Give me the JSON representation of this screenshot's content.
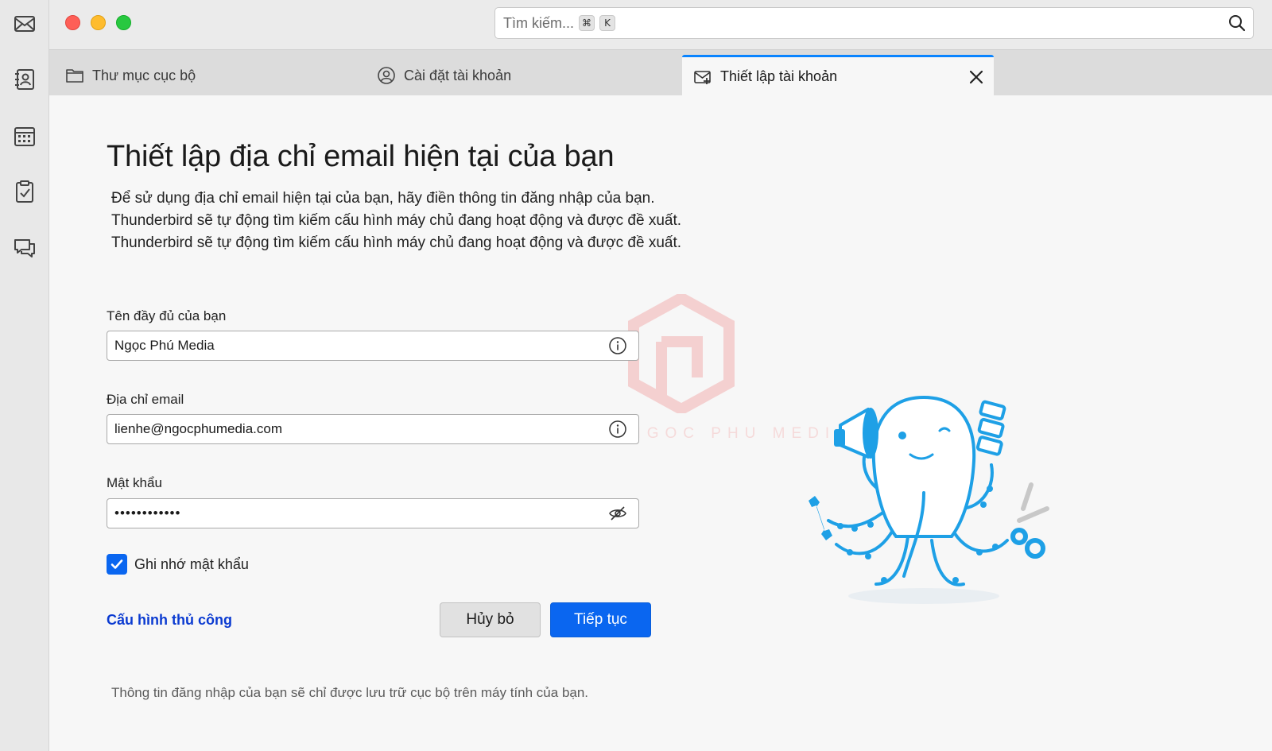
{
  "search": {
    "placeholder": "Tìm kiếm...",
    "shortcut_keys": [
      "⌘",
      "K"
    ]
  },
  "spaces_toolbar": {
    "items": [
      "mail-icon",
      "address-book-icon",
      "calendar-icon",
      "tasks-icon",
      "chat-icon"
    ]
  },
  "tabs": [
    {
      "label": "Thư mục cục bộ",
      "icon": "folder-icon",
      "active": false,
      "closable": false
    },
    {
      "label": "Cài đặt tài khoản",
      "icon": "account-icon",
      "active": false,
      "closable": true
    },
    {
      "label": "Thiết lập tài khoản",
      "icon": "mail-setup-icon",
      "active": true,
      "closable": true
    }
  ],
  "page": {
    "title": "Thiết lập địa chỉ email hiện tại của bạn",
    "description": [
      "Để sử dụng địa chỉ email hiện tại của bạn, hãy điền thông tin đăng nhập của bạn.",
      "Thunderbird sẽ tự động tìm kiếm cấu hình máy chủ đang hoạt động và được đề xuất.",
      "Thunderbird sẽ tự động tìm kiếm cấu hình máy chủ đang hoạt động và được đề xuất."
    ]
  },
  "form": {
    "fullname": {
      "label": "Tên đầy đủ của bạn",
      "value": "Ngọc Phú Media"
    },
    "email": {
      "label": "Địa chỉ email",
      "value": "lienhe@ngocphumedia.com"
    },
    "password": {
      "label": "Mật khẩu",
      "value": "••••••••••••"
    },
    "remember": {
      "label": "Ghi nhớ mật khẩu",
      "checked": true
    }
  },
  "actions": {
    "manual_config": "Cấu hình thủ công",
    "cancel": "Hủy bỏ",
    "continue": "Tiếp tục"
  },
  "footnote": "Thông tin đăng nhập của bạn sẽ chỉ được lưu trữ cục bộ trên máy tính của bạn.",
  "watermark": {
    "text": "NGOC PHU MEDIA"
  },
  "colors": {
    "accent": "#0a66f0",
    "tab_indicator": "#0a84ff",
    "mascot": "#1ea0e6",
    "link": "#0b3bd1"
  }
}
